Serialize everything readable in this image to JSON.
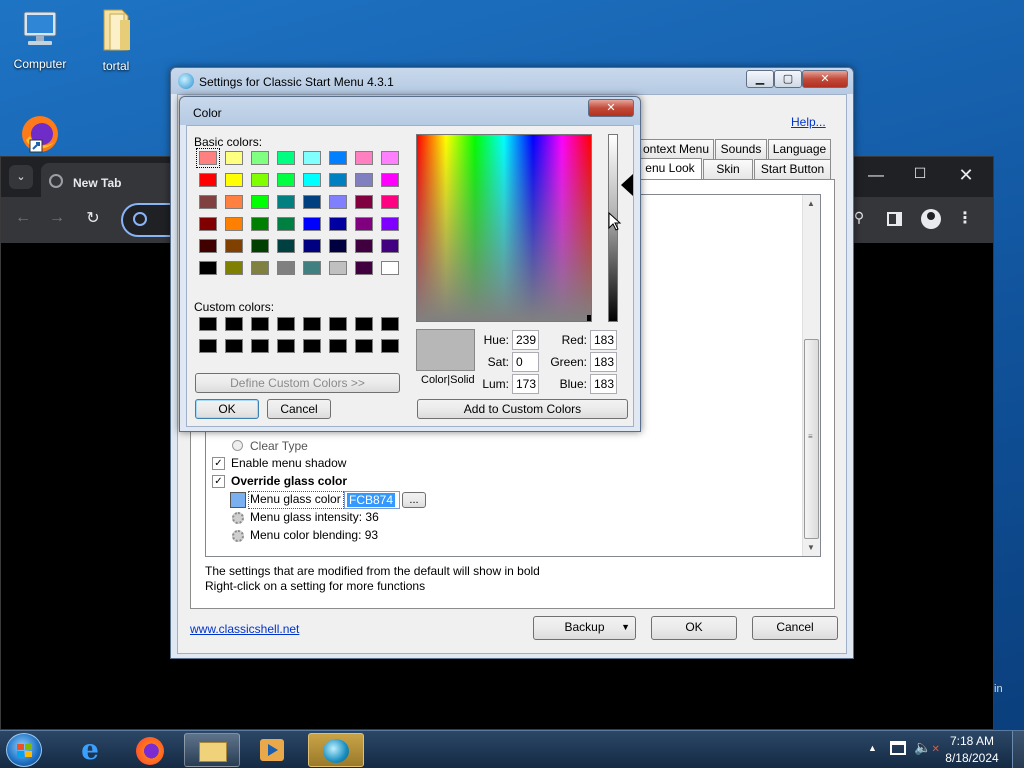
{
  "desktop": {
    "icons": [
      {
        "label": "Computer",
        "icon": "computer-icon"
      },
      {
        "label": "tortal",
        "icon": "folder-icon"
      },
      {
        "label": "",
        "icon": "firefox-icon"
      }
    ]
  },
  "chrome": {
    "tab_title": "New Tab",
    "partial_right_text": "in"
  },
  "settings": {
    "title": "Settings for Classic Start Menu 4.3.1",
    "help_link": "Help...",
    "tabs_row1": [
      "ontext Menu",
      "Sounds",
      "Language"
    ],
    "tabs_row2": [
      "enu Look",
      "Skin",
      "Start Button"
    ],
    "items": {
      "clear_type": "Clear Type",
      "enable_shadow": "Enable menu shadow",
      "override_glass": "Override glass color",
      "glass_color_label": "Menu glass color",
      "glass_color_value": "FCB874",
      "glass_intensity": "Menu glass intensity: 36",
      "color_blending": "Menu color blending: 93",
      "browse_btn": "..."
    },
    "info_line1": "The settings that are modified from the default will show in bold",
    "info_line2": "Right-click on a setting for more functions",
    "website": "www.classicshell.net",
    "backup_btn": "Backup",
    "ok_btn": "OK",
    "cancel_btn": "Cancel",
    "glass_swatch_color": "#7ab0f0"
  },
  "color_dialog": {
    "title": "Color",
    "basic_colors_label": "Basic colors:",
    "custom_colors_label": "Custom colors:",
    "define_custom_btn": "Define Custom Colors >>",
    "ok_btn": "OK",
    "cancel_btn": "Cancel",
    "add_custom_btn": "Add to Custom Colors",
    "color_solid_label": "Color|Solid",
    "preview_color": "#b7b7b7",
    "fields": {
      "hue_label": "Hue:",
      "hue": "239",
      "sat_label": "Sat:",
      "sat": "0",
      "lum_label": "Lum:",
      "lum": "173",
      "red_label": "Red:",
      "red": "183",
      "green_label": "Green:",
      "green": "183",
      "blue_label": "Blue:",
      "blue": "183"
    },
    "basic_colors": [
      "#ff8080",
      "#ffff80",
      "#80ff80",
      "#00ff80",
      "#80ffff",
      "#0080ff",
      "#ff80c0",
      "#ff80ff",
      "#ff0000",
      "#ffff00",
      "#80ff00",
      "#00ff40",
      "#00ffff",
      "#0080c0",
      "#8080c0",
      "#ff00ff",
      "#804040",
      "#ff8040",
      "#00ff00",
      "#008080",
      "#004080",
      "#8080ff",
      "#800040",
      "#ff0080",
      "#800000",
      "#ff8000",
      "#008000",
      "#008040",
      "#0000ff",
      "#0000a0",
      "#800080",
      "#8000ff",
      "#400000",
      "#804000",
      "#004000",
      "#004040",
      "#000080",
      "#000040",
      "#400040",
      "#400080",
      "#000000",
      "#808000",
      "#808040",
      "#808080",
      "#408080",
      "#c0c0c0",
      "#400040",
      "#ffffff"
    ]
  },
  "taskbar": {
    "time": "7:18 AM",
    "date": "8/18/2024",
    "items": [
      "start-orb-icon",
      "internet-explorer-icon",
      "firefox-icon",
      "file-explorer-icon",
      "media-player-icon",
      "classic-shell-icon"
    ]
  }
}
